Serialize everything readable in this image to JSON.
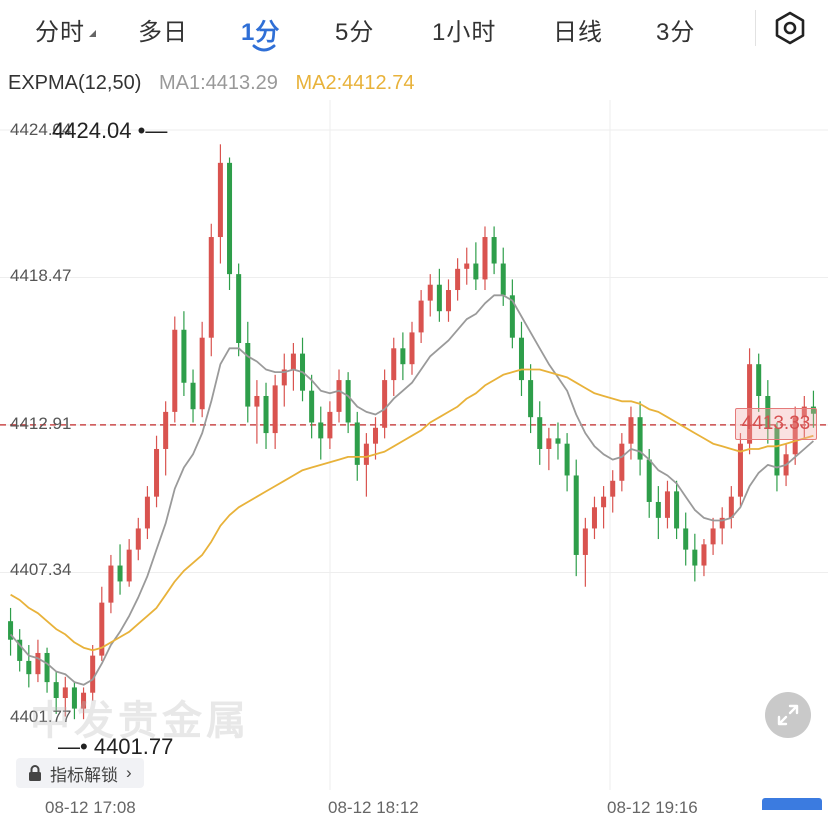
{
  "tabs": [
    {
      "label": "分时",
      "active": false
    },
    {
      "label": "多日",
      "active": false
    },
    {
      "label": "1分",
      "active": true
    },
    {
      "label": "5分",
      "active": false
    },
    {
      "label": "1小时",
      "active": false
    },
    {
      "label": "日线",
      "active": false
    },
    {
      "label": "3分",
      "active": false
    }
  ],
  "icons": {
    "settings": "hexagon-settings-icon",
    "lock": "lock-icon",
    "expand": "expand-arrows-icon",
    "chevron": "chevron-right-icon"
  },
  "legend": {
    "indicator": "EXPMA(12,50)",
    "ma1": "MA1:4413.29",
    "ma2": "MA2:4412.74"
  },
  "colors": {
    "up": "#d9534f",
    "down": "#2e9e4a",
    "ma1": "#9a9a9a",
    "ma2": "#e8b23a",
    "accent": "#2f6fd6",
    "dash": "#c94a4a"
  },
  "axis": {
    "ticks": [
      "4424.04",
      "4418.47",
      "4412.91",
      "4407.34",
      "4401.77"
    ],
    "max_label": "4424.04",
    "min_label": "4401.77",
    "current_price": "4413.33",
    "x_labels": [
      "08-12 17:08",
      "08-12 18:12",
      "08-12 19:16"
    ]
  },
  "unlock_label": "指标解锁",
  "unlock_chevron": "›",
  "watermark": "中发贵金属",
  "chart_data": {
    "type": "candlestick",
    "ylim": [
      4401.77,
      4424.04
    ],
    "reference_line": 4412.91,
    "ohlc": [
      [
        4405.5,
        4406.0,
        4404.2,
        4404.8
      ],
      [
        4404.8,
        4405.2,
        4403.6,
        4404.0
      ],
      [
        4404.0,
        4404.6,
        4403.0,
        4403.5
      ],
      [
        4403.5,
        4404.8,
        4403.2,
        4404.3
      ],
      [
        4404.3,
        4404.5,
        4402.8,
        4403.2
      ],
      [
        4403.2,
        4403.6,
        4402.0,
        4402.6
      ],
      [
        4402.6,
        4403.4,
        4401.9,
        4403.0
      ],
      [
        4403.0,
        4403.2,
        4401.8,
        4402.2
      ],
      [
        4402.2,
        4403.0,
        4401.8,
        4402.8
      ],
      [
        4402.8,
        4404.6,
        4402.5,
        4404.2
      ],
      [
        4404.2,
        4406.8,
        4404.0,
        4406.2
      ],
      [
        4406.2,
        4408.0,
        4405.8,
        4407.6
      ],
      [
        4407.6,
        4408.4,
        4406.5,
        4407.0
      ],
      [
        4407.0,
        4408.6,
        4406.8,
        4408.2
      ],
      [
        4408.2,
        4409.4,
        4407.8,
        4409.0
      ],
      [
        4409.0,
        4410.6,
        4408.6,
        4410.2
      ],
      [
        4410.2,
        4412.5,
        4409.8,
        4412.0
      ],
      [
        4412.0,
        4413.8,
        4411.0,
        4413.4
      ],
      [
        4413.4,
        4417.0,
        4413.0,
        4416.5
      ],
      [
        4416.5,
        4417.2,
        4414.0,
        4414.5
      ],
      [
        4414.5,
        4415.0,
        4413.0,
        4413.5
      ],
      [
        4413.5,
        4416.8,
        4413.2,
        4416.2
      ],
      [
        4416.2,
        4420.5,
        4415.5,
        4420.0
      ],
      [
        4420.0,
        4423.5,
        4419.0,
        4422.8
      ],
      [
        4422.8,
        4423.0,
        4418.0,
        4418.6
      ],
      [
        4418.6,
        4419.0,
        4415.5,
        4416.0
      ],
      [
        4416.0,
        4416.8,
        4413.0,
        4413.6
      ],
      [
        4413.6,
        4414.6,
        4412.2,
        4414.0
      ],
      [
        4414.0,
        4414.5,
        4412.0,
        4412.6
      ],
      [
        4412.6,
        4414.8,
        4412.0,
        4414.4
      ],
      [
        4414.4,
        4415.6,
        4413.6,
        4415.0
      ],
      [
        4415.0,
        4416.0,
        4414.2,
        4415.6
      ],
      [
        4415.6,
        4416.2,
        4413.8,
        4414.2
      ],
      [
        4414.2,
        4414.8,
        4412.4,
        4413.0
      ],
      [
        4413.0,
        4413.6,
        4411.6,
        4412.4
      ],
      [
        4412.4,
        4413.8,
        4412.0,
        4413.4
      ],
      [
        4413.4,
        4415.0,
        4413.0,
        4414.6
      ],
      [
        4414.6,
        4414.9,
        4412.6,
        4413.0
      ],
      [
        4413.0,
        4413.4,
        4410.8,
        4411.4
      ],
      [
        4411.4,
        4412.6,
        4410.2,
        4412.2
      ],
      [
        4412.2,
        4413.2,
        4411.6,
        4412.8
      ],
      [
        4412.8,
        4415.0,
        4412.4,
        4414.6
      ],
      [
        4414.6,
        4416.2,
        4414.0,
        4415.8
      ],
      [
        4415.8,
        4416.4,
        4414.6,
        4415.2
      ],
      [
        4415.2,
        4416.8,
        4414.8,
        4416.4
      ],
      [
        4416.4,
        4418.0,
        4416.0,
        4417.6
      ],
      [
        4417.6,
        4418.6,
        4417.0,
        4418.2
      ],
      [
        4418.2,
        4418.8,
        4416.8,
        4417.2
      ],
      [
        4417.2,
        4418.4,
        4416.8,
        4418.0
      ],
      [
        4418.0,
        4419.2,
        4417.6,
        4418.8
      ],
      [
        4418.8,
        4419.6,
        4418.2,
        4419.0
      ],
      [
        4419.0,
        4419.8,
        4418.0,
        4418.4
      ],
      [
        4418.4,
        4420.4,
        4418.0,
        4420.0
      ],
      [
        4420.0,
        4420.4,
        4418.6,
        4419.0
      ],
      [
        4419.0,
        4419.6,
        4417.4,
        4417.8
      ],
      [
        4417.8,
        4418.4,
        4415.8,
        4416.2
      ],
      [
        4416.2,
        4416.8,
        4414.0,
        4414.6
      ],
      [
        4414.6,
        4415.2,
        4412.6,
        4413.2
      ],
      [
        4413.2,
        4413.8,
        4411.4,
        4412.0
      ],
      [
        4412.0,
        4412.8,
        4411.2,
        4412.4
      ],
      [
        4412.4,
        4413.0,
        4411.6,
        4412.2
      ],
      [
        4412.2,
        4412.6,
        4410.4,
        4411.0
      ],
      [
        4411.0,
        4411.6,
        4407.2,
        4408.0
      ],
      [
        4408.0,
        4409.4,
        4406.8,
        4409.0
      ],
      [
        4409.0,
        4410.2,
        4408.6,
        4409.8
      ],
      [
        4409.8,
        4410.6,
        4409.0,
        4410.2
      ],
      [
        4410.2,
        4411.2,
        4409.6,
        4410.8
      ],
      [
        4410.8,
        4412.6,
        4410.4,
        4412.2
      ],
      [
        4412.2,
        4413.6,
        4411.6,
        4413.2
      ],
      [
        4413.2,
        4413.8,
        4411.0,
        4411.6
      ],
      [
        4411.6,
        4412.0,
        4409.4,
        4410.0
      ],
      [
        4410.0,
        4410.6,
        4408.6,
        4409.4
      ],
      [
        4409.4,
        4410.8,
        4409.0,
        4410.4
      ],
      [
        4410.4,
        4410.8,
        4408.6,
        4409.0
      ],
      [
        4409.0,
        4409.6,
        4407.6,
        4408.2
      ],
      [
        4408.2,
        4408.8,
        4407.0,
        4407.6
      ],
      [
        4407.6,
        4408.6,
        4407.2,
        4408.4
      ],
      [
        4408.4,
        4409.4,
        4408.0,
        4409.0
      ],
      [
        4409.0,
        4409.8,
        4408.4,
        4409.4
      ],
      [
        4409.4,
        4410.6,
        4409.0,
        4410.2
      ],
      [
        4410.2,
        4412.6,
        4409.8,
        4412.2
      ],
      [
        4412.2,
        4415.8,
        4411.8,
        4415.2
      ],
      [
        4415.2,
        4415.6,
        4413.4,
        4414.0
      ],
      [
        4414.0,
        4414.6,
        4412.2,
        4412.8
      ],
      [
        4412.8,
        4413.0,
        4410.4,
        4411.0
      ],
      [
        4411.0,
        4412.2,
        4410.6,
        4411.8
      ],
      [
        4411.8,
        4413.6,
        4411.4,
        4413.2
      ],
      [
        4413.2,
        4414.0,
        4412.4,
        4413.6
      ],
      [
        4413.6,
        4414.2,
        4412.8,
        4413.33
      ]
    ],
    "series": [
      {
        "name": "MA1",
        "values": [
          4405.0,
          4404.6,
          4404.2,
          4404.1,
          4403.9,
          4403.6,
          4403.5,
          4403.2,
          4403.1,
          4403.3,
          4403.9,
          4404.6,
          4405.1,
          4405.7,
          4406.4,
          4407.2,
          4408.2,
          4409.2,
          4410.5,
          4411.3,
          4411.8,
          4412.6,
          4413.8,
          4415.2,
          4415.8,
          4415.8,
          4415.5,
          4415.3,
          4415.0,
          4414.9,
          4414.9,
          4415.0,
          4414.9,
          4414.6,
          4414.2,
          4414.1,
          4414.2,
          4414.0,
          4413.6,
          4413.4,
          4413.3,
          4413.5,
          4413.9,
          4414.2,
          4414.5,
          4415.0,
          4415.5,
          4415.8,
          4416.1,
          4416.5,
          4416.9,
          4417.1,
          4417.5,
          4417.8,
          4417.8,
          4417.6,
          4417.0,
          4416.4,
          4415.8,
          4415.2,
          4414.7,
          4414.2,
          4413.3,
          4412.6,
          4412.1,
          4411.8,
          4411.6,
          4411.7,
          4412.0,
          4411.9,
          4411.6,
          4411.2,
          4411.0,
          4410.7,
          4410.2,
          4409.7,
          4409.4,
          4409.3,
          4409.3,
          4409.4,
          4409.8,
          4410.6,
          4411.1,
          4411.4,
          4411.3,
          4411.4,
          4411.7,
          4412.0,
          4412.3
        ]
      },
      {
        "name": "MA2",
        "values": [
          4406.5,
          4406.3,
          4406.0,
          4405.8,
          4405.5,
          4405.2,
          4405.0,
          4404.7,
          4404.5,
          4404.4,
          4404.5,
          4404.7,
          4404.9,
          4405.1,
          4405.4,
          4405.7,
          4406.0,
          4406.5,
          4407.0,
          4407.4,
          4407.7,
          4408.0,
          4408.5,
          4409.1,
          4409.5,
          4409.8,
          4410.0,
          4410.2,
          4410.4,
          4410.6,
          4410.8,
          4411.0,
          4411.2,
          4411.3,
          4411.4,
          4411.5,
          4411.6,
          4411.7,
          4411.7,
          4411.7,
          4411.8,
          4411.9,
          4412.1,
          4412.3,
          4412.5,
          4412.7,
          4413.0,
          4413.2,
          4413.4,
          4413.6,
          4413.9,
          4414.1,
          4414.4,
          4414.6,
          4414.8,
          4414.9,
          4415.0,
          4415.0,
          4415.0,
          4414.9,
          4414.8,
          4414.7,
          4414.5,
          4414.3,
          4414.1,
          4414.0,
          4413.9,
          4413.8,
          4413.8,
          4413.7,
          4413.5,
          4413.4,
          4413.2,
          4413.0,
          4412.8,
          4412.6,
          4412.4,
          4412.2,
          4412.1,
          4412.0,
          4411.9,
          4412.0,
          4412.0,
          4412.1,
          4412.1,
          4412.2,
          4412.3,
          4412.4,
          4412.5
        ]
      }
    ]
  }
}
